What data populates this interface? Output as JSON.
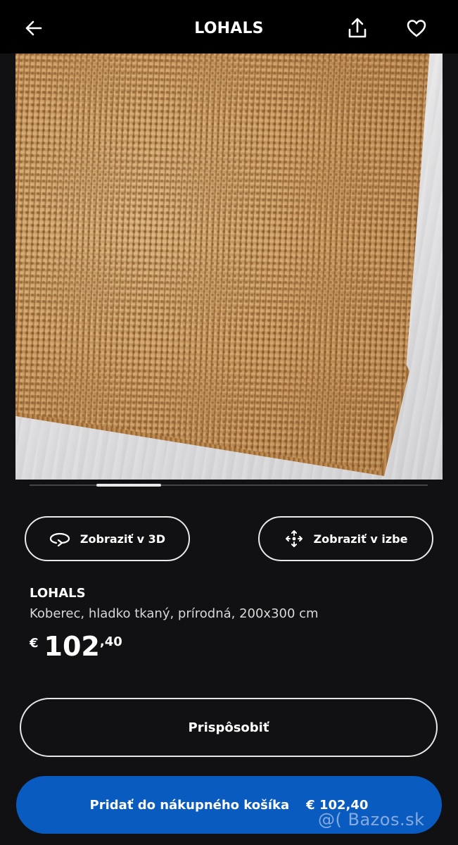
{
  "header": {
    "title": "LOHALS",
    "back_icon": "arrow-left-icon",
    "share_icon": "share-icon",
    "favorite_icon": "heart-icon"
  },
  "gallery": {
    "image": "jute rug on light floor",
    "current_index": 2
  },
  "actions": {
    "view_3d": {
      "label": "Zobraziť v 3D",
      "icon": "rotate-3d-icon"
    },
    "view_room": {
      "label": "Zobraziť v izbe",
      "icon": "ar-view-icon"
    }
  },
  "product": {
    "name": "LOHALS",
    "description": "Koberec, hladko tkaný, prírodná, 200x300 cm",
    "price": {
      "currency": "€",
      "integer": "102",
      "decimal": ",40"
    }
  },
  "customize": {
    "label": "Prispôsobiť"
  },
  "cart": {
    "label": "Pridať do nákupného košíka",
    "price": "€ 102,40"
  },
  "watermark": "@( Bazos.sk",
  "colors": {
    "background": "#111113",
    "header": "#000000",
    "primary": "#0a5bbf",
    "text": "#ffffff"
  }
}
